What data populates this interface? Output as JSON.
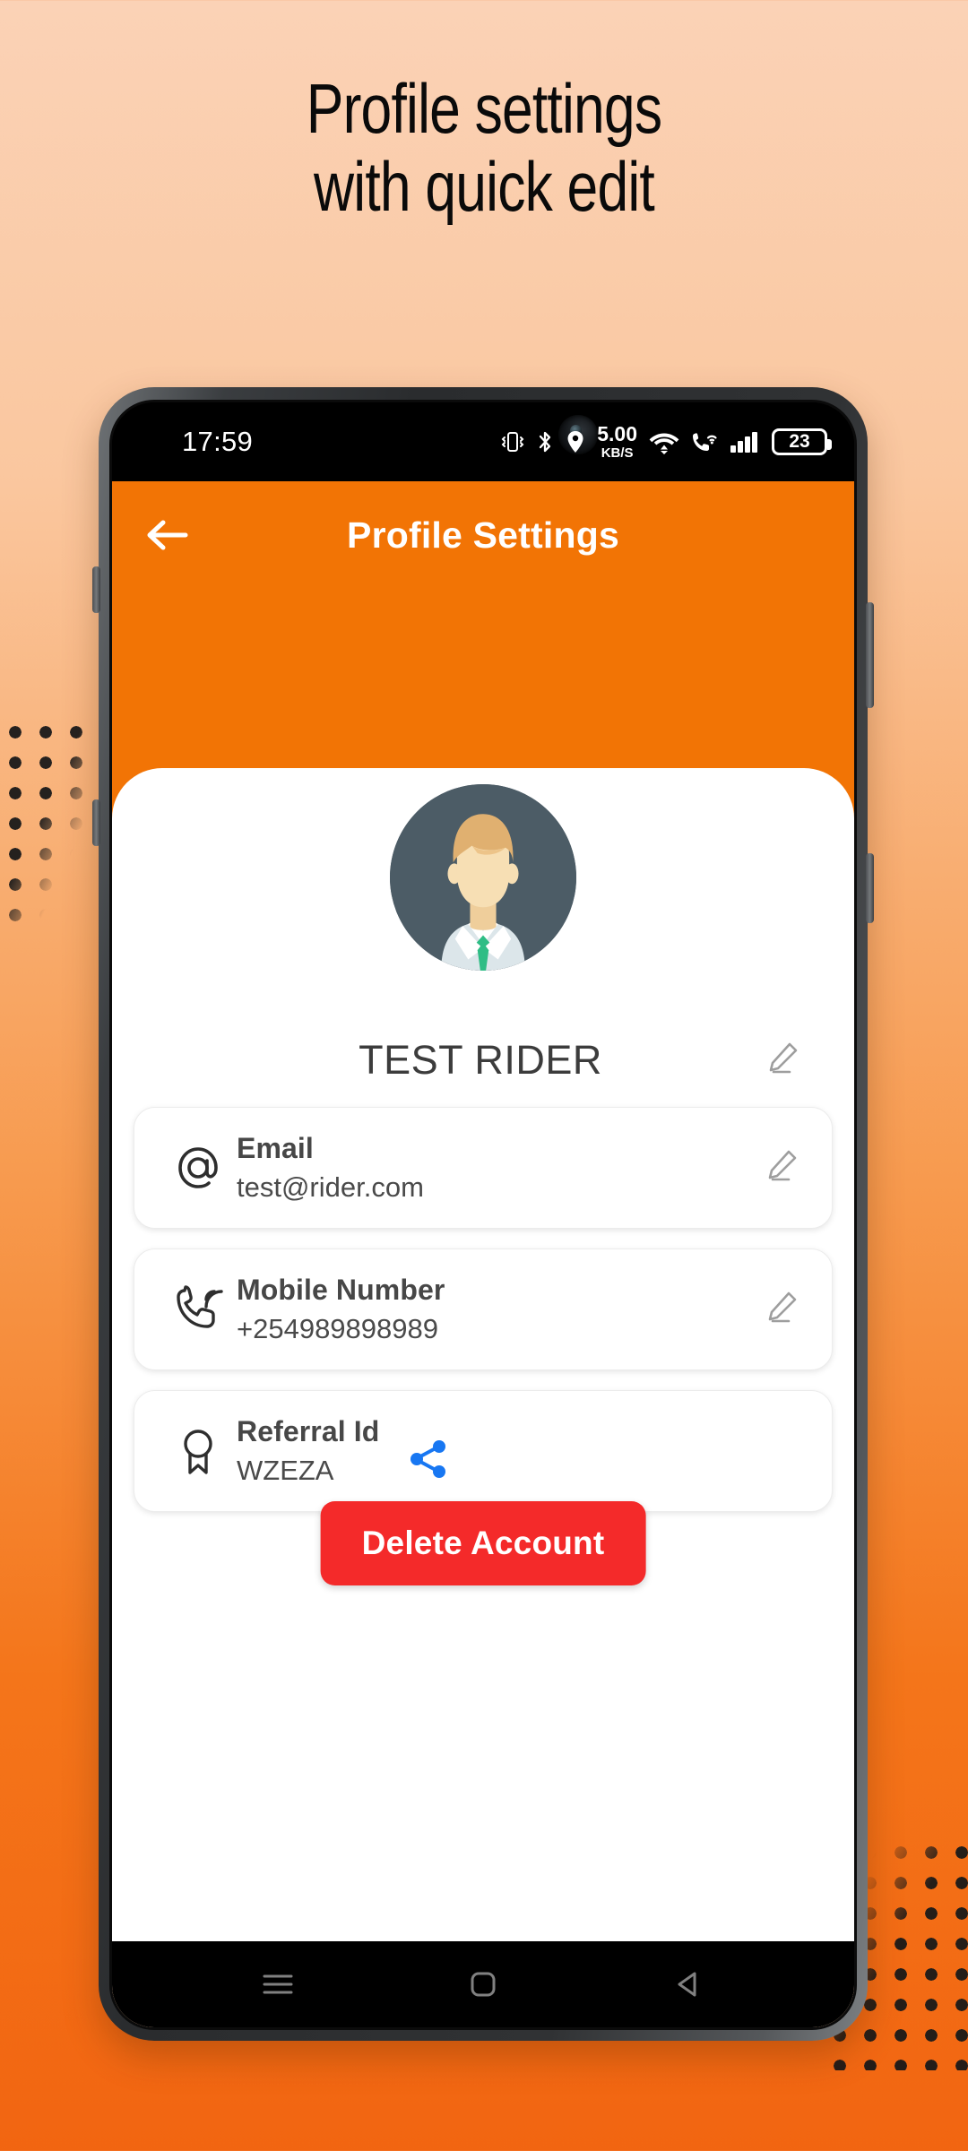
{
  "promo": {
    "headline_line1": "Profile settings",
    "headline_line2": "with quick edit",
    "bg_top_color": "#FBD2B6",
    "bg_bottom_color": "#F26511",
    "dot_color": "#1A1A1A"
  },
  "status_bar": {
    "clock": "17:59",
    "net_speed_value": "5.00",
    "net_speed_unit": "KB/S",
    "battery_percent": "23",
    "icons": [
      "camera-punch-hole-icon",
      "vibrate-icon",
      "bluetooth-icon",
      "location-icon",
      "network-speed-icon",
      "wifi-icon",
      "wifi-calling-icon",
      "signal-bars-icon",
      "battery-icon"
    ]
  },
  "app": {
    "accent_color": "#F27405",
    "header": {
      "title": "Profile Settings",
      "back_icon": "arrow-left-icon"
    },
    "avatar": {
      "icon": "user-avatar-icon",
      "bg_color": "#4C5C66",
      "tie_color": "#2FBD85",
      "hair_color": "#E0B070",
      "skin_color": "#F7DFB4",
      "shirt_color": "#DCE6EA"
    },
    "profile_name": "TEST RIDER",
    "name_edit_icon": "pencil-icon",
    "cards": [
      {
        "icon": "at-sign-icon",
        "label": "Email",
        "value": "test@rider.com",
        "action_icon": "pencil-icon"
      },
      {
        "icon": "phone-ring-icon",
        "label": "Mobile Number",
        "value": "+254989898989",
        "action_icon": "pencil-icon"
      },
      {
        "icon": "award-ribbon-icon",
        "label": "Referral Id",
        "value": "WZEZA",
        "action_icon": "share-icon",
        "action_icon_color": "#1877F2"
      }
    ],
    "delete_button": {
      "label": "Delete Account",
      "color": "#F42A2A"
    }
  },
  "nav_bar": {
    "recents_icon": "menu-lines-icon",
    "home_icon": "home-square-icon",
    "back_icon": "triangle-back-icon"
  }
}
